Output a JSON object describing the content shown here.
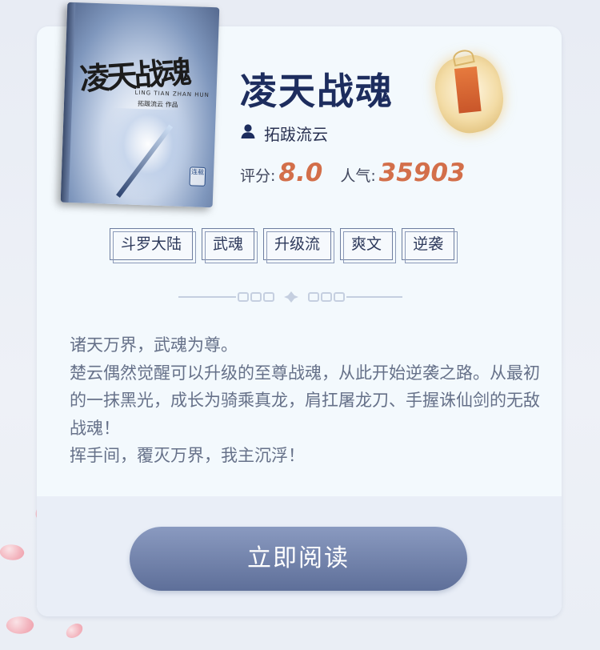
{
  "book": {
    "cover_title": "凌天战魂",
    "cover_subtitle": "LING TIAN ZHAN HUN",
    "cover_author_line": "拓跋流云 作品",
    "cover_seal": "连载",
    "title": "凌天战魂",
    "author": "拓跋流云",
    "rating_label": "评分:",
    "rating_value": "8.0",
    "popularity_label": "人气:",
    "popularity_value": "35903"
  },
  "tags": [
    "斗罗大陆",
    "武魂",
    "升级流",
    "爽文",
    "逆袭"
  ],
  "description": [
    "诸天万界，武魂为尊。",
    "楚云偶然觉醒可以升级的至尊战魂，从此开始逆袭之路。从最初的一抹黑光，成长为骑乘真龙，肩扛屠龙刀、手握诛仙剑的无敌战魂！",
    "挥手间，覆灭万界，我主沉浮！"
  ],
  "actions": {
    "read_label": "立即阅读"
  },
  "icons": {
    "author": "user-icon",
    "divider": "ornament-icon",
    "charm": "amulet-icon"
  },
  "colors": {
    "title": "#1d2d5e",
    "accent": "#d36f4a",
    "button": "#5e6f99",
    "text": "#667189"
  }
}
